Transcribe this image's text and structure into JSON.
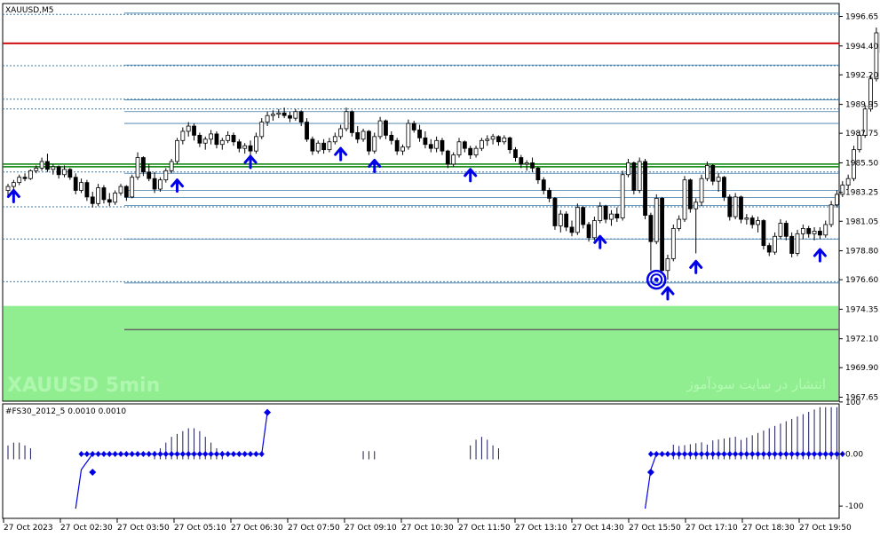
{
  "main_chart": {
    "title": "XAUUSD,M5",
    "watermark_left": "XAUUSD    5min",
    "watermark_right": "انتشار در سایت سودآموز",
    "price_ticks": [
      "1996.65",
      "1994.40",
      "1992.20",
      "1989.95",
      "1987.75",
      "1985.50",
      "1983.25",
      "1981.05",
      "1978.80",
      "1976.60",
      "1974.35",
      "1972.10",
      "1969.90",
      "1967.65"
    ],
    "price_range": [
      1967.65,
      1996.65
    ],
    "zone_band": [
      1967.65,
      1974.6
    ],
    "lines": {
      "red": 1994.6,
      "green": [
        1985.4,
        1985.2
      ],
      "solid": [
        1996.9,
        1992.95,
        1990.3,
        1989.4,
        1988.5,
        1984.7,
        1983.4,
        1982.85,
        1982.25,
        1979.7,
        1976.35,
        1972.8
      ],
      "dashed": [
        1996.8,
        1992.9,
        1990.35,
        1989.6,
        1984.8,
        1982.15,
        1979.7,
        1976.45
      ]
    },
    "arrows": [
      {
        "bar": 1,
        "price": 1983.4
      },
      {
        "bar": 30,
        "price": 1984.2
      },
      {
        "bar": 43,
        "price": 1986.0
      },
      {
        "bar": 59,
        "price": 1986.6
      },
      {
        "bar": 65,
        "price": 1985.7
      },
      {
        "bar": 82,
        "price": 1985.0
      },
      {
        "bar": 105,
        "price": 1979.9
      },
      {
        "bar": 117,
        "price": 1976.0
      },
      {
        "bar": 122,
        "price": 1978.0
      },
      {
        "bar": 144,
        "price": 1978.9
      }
    ],
    "target_marker": {
      "bar": 115,
      "price": 1976.6
    }
  },
  "indicator": {
    "title": "#FS30_2012_5 0.0010 0.0010",
    "ticks": [
      "100",
      "0.00",
      "-100"
    ],
    "range": [
      -110,
      110
    ]
  },
  "time_labels": [
    "27 Oct 2023",
    "27 Oct 02:30",
    "27 Oct 03:50",
    "27 Oct 05:10",
    "27 Oct 06:30",
    "27 Oct 07:50",
    "27 Oct 09:10",
    "27 Oct 10:30",
    "27 Oct 11:50",
    "27 Oct 13:10",
    "27 Oct 14:30",
    "27 Oct 15:50",
    "27 Oct 17:10",
    "27 Oct 18:30",
    "27 Oct 19:50"
  ],
  "colors": {
    "zone": "#90ee90",
    "red_line": "#cc0000",
    "green_line": "#008000",
    "level_line": "#3a78a8",
    "arrow": "#0000e6",
    "indicator_bar": "#1a1a5e",
    "indicator_dot": "#0000e6"
  },
  "candles": [
    [
      1983.4,
      1983.9,
      1982.9,
      1983.7
    ],
    [
      1983.7,
      1984.2,
      1983.4,
      1984.0
    ],
    [
      1984.0,
      1984.6,
      1983.8,
      1984.4
    ],
    [
      1984.4,
      1984.7,
      1984.1,
      1984.3
    ],
    [
      1984.3,
      1985.0,
      1984.2,
      1984.9
    ],
    [
      1984.9,
      1985.3,
      1984.7,
      1985.1
    ],
    [
      1985.1,
      1985.9,
      1984.9,
      1985.6
    ],
    [
      1985.6,
      1986.2,
      1984.8,
      1985.0
    ],
    [
      1985.0,
      1985.4,
      1984.6,
      1985.2
    ],
    [
      1985.2,
      1985.3,
      1984.3,
      1984.6
    ],
    [
      1984.6,
      1985.3,
      1984.4,
      1985.0
    ],
    [
      1985.0,
      1985.1,
      1984.2,
      1984.4
    ],
    [
      1984.4,
      1984.7,
      1983.1,
      1983.4
    ],
    [
      1983.4,
      1984.3,
      1983.2,
      1984.0
    ],
    [
      1984.0,
      1984.2,
      1982.6,
      1982.9
    ],
    [
      1982.9,
      1983.3,
      1982.1,
      1982.4
    ],
    [
      1982.4,
      1983.9,
      1982.2,
      1983.6
    ],
    [
      1983.6,
      1983.8,
      1982.4,
      1982.7
    ],
    [
      1982.7,
      1983.2,
      1982.2,
      1982.5
    ],
    [
      1982.5,
      1983.4,
      1982.3,
      1983.2
    ],
    [
      1983.2,
      1983.9,
      1983.0,
      1983.7
    ],
    [
      1983.7,
      1983.8,
      1982.6,
      1982.9
    ],
    [
      1982.9,
      1984.6,
      1982.8,
      1984.4
    ],
    [
      1984.4,
      1986.3,
      1984.2,
      1985.9
    ],
    [
      1985.9,
      1986.0,
      1984.5,
      1984.8
    ],
    [
      1984.8,
      1985.4,
      1984.1,
      1984.3
    ],
    [
      1984.3,
      1984.8,
      1983.2,
      1983.5
    ],
    [
      1983.5,
      1984.4,
      1983.3,
      1984.2
    ],
    [
      1984.2,
      1985.1,
      1984.0,
      1984.9
    ],
    [
      1984.9,
      1985.8,
      1984.7,
      1985.6
    ],
    [
      1985.6,
      1987.4,
      1985.4,
      1987.2
    ],
    [
      1987.2,
      1988.2,
      1986.9,
      1987.9
    ],
    [
      1987.9,
      1988.6,
      1987.5,
      1988.3
    ],
    [
      1988.3,
      1988.5,
      1987.2,
      1987.6
    ],
    [
      1987.6,
      1987.8,
      1986.7,
      1987.0
    ],
    [
      1987.0,
      1987.5,
      1986.5,
      1987.3
    ],
    [
      1987.3,
      1988.0,
      1986.9,
      1987.7
    ],
    [
      1987.7,
      1987.9,
      1986.6,
      1986.9
    ],
    [
      1986.9,
      1987.4,
      1986.5,
      1987.2
    ],
    [
      1987.2,
      1987.9,
      1987.0,
      1987.6
    ],
    [
      1987.6,
      1987.8,
      1986.8,
      1987.1
    ],
    [
      1987.1,
      1987.3,
      1986.3,
      1986.6
    ],
    [
      1986.6,
      1987.0,
      1986.2,
      1986.8
    ],
    [
      1986.8,
      1987.2,
      1986.1,
      1986.4
    ],
    [
      1986.4,
      1987.8,
      1986.2,
      1987.5
    ],
    [
      1987.5,
      1988.9,
      1987.3,
      1988.6
    ],
    [
      1988.6,
      1989.4,
      1988.3,
      1989.1
    ],
    [
      1989.1,
      1989.5,
      1988.7,
      1989.2
    ],
    [
      1989.2,
      1989.6,
      1988.9,
      1989.3
    ],
    [
      1989.3,
      1989.7,
      1988.9,
      1989.1
    ],
    [
      1989.1,
      1989.4,
      1988.6,
      1988.9
    ],
    [
      1988.9,
      1989.6,
      1988.7,
      1989.4
    ],
    [
      1989.4,
      1989.5,
      1988.3,
      1988.6
    ],
    [
      1988.6,
      1988.9,
      1987.1,
      1987.3
    ],
    [
      1987.3,
      1987.5,
      1986.1,
      1986.4
    ],
    [
      1986.4,
      1987.2,
      1986.2,
      1987.0
    ],
    [
      1987.0,
      1987.3,
      1986.2,
      1986.5
    ],
    [
      1986.5,
      1987.4,
      1986.3,
      1987.1
    ],
    [
      1987.1,
      1987.8,
      1986.9,
      1987.5
    ],
    [
      1987.5,
      1988.4,
      1987.3,
      1988.1
    ],
    [
      1988.1,
      1989.7,
      1987.9,
      1989.4
    ],
    [
      1989.4,
      1989.5,
      1987.5,
      1987.8
    ],
    [
      1987.8,
      1988.3,
      1987.0,
      1987.3
    ],
    [
      1987.3,
      1988.1,
      1987.1,
      1987.9
    ],
    [
      1987.9,
      1988.0,
      1986.1,
      1986.4
    ],
    [
      1986.4,
      1987.8,
      1986.2,
      1987.5
    ],
    [
      1987.5,
      1989.0,
      1987.3,
      1988.7
    ],
    [
      1988.7,
      1988.8,
      1987.3,
      1987.6
    ],
    [
      1987.6,
      1987.9,
      1986.9,
      1987.2
    ],
    [
      1987.2,
      1987.4,
      1986.1,
      1986.4
    ],
    [
      1986.4,
      1986.9,
      1986.1,
      1986.7
    ],
    [
      1986.7,
      1988.8,
      1986.5,
      1988.5
    ],
    [
      1988.5,
      1988.7,
      1987.8,
      1988.0
    ],
    [
      1988.0,
      1988.4,
      1987.1,
      1987.4
    ],
    [
      1987.4,
      1987.9,
      1986.6,
      1986.9
    ],
    [
      1986.9,
      1987.3,
      1986.3,
      1986.6
    ],
    [
      1986.6,
      1987.5,
      1986.3,
      1987.2
    ],
    [
      1987.2,
      1987.4,
      1986.1,
      1986.4
    ],
    [
      1986.4,
      1986.5,
      1985.1,
      1985.4
    ],
    [
      1985.4,
      1986.3,
      1985.2,
      1986.1
    ],
    [
      1986.1,
      1987.4,
      1985.9,
      1987.1
    ],
    [
      1987.1,
      1987.2,
      1986.3,
      1986.6
    ],
    [
      1986.6,
      1986.8,
      1985.8,
      1986.1
    ],
    [
      1986.1,
      1986.8,
      1985.9,
      1986.6
    ],
    [
      1986.6,
      1987.4,
      1986.4,
      1987.2
    ],
    [
      1987.2,
      1987.6,
      1986.8,
      1987.3
    ],
    [
      1987.3,
      1987.7,
      1986.9,
      1987.5
    ],
    [
      1987.5,
      1987.6,
      1986.8,
      1987.1
    ],
    [
      1987.1,
      1987.6,
      1986.9,
      1987.4
    ],
    [
      1987.4,
      1987.5,
      1986.2,
      1986.5
    ],
    [
      1986.5,
      1986.7,
      1985.6,
      1985.9
    ],
    [
      1985.9,
      1986.1,
      1985.1,
      1985.4
    ],
    [
      1985.4,
      1985.7,
      1984.9,
      1985.5
    ],
    [
      1985.5,
      1985.9,
      1984.8,
      1985.1
    ],
    [
      1985.1,
      1985.2,
      1983.9,
      1984.2
    ],
    [
      1984.2,
      1984.4,
      1983.1,
      1983.4
    ],
    [
      1983.4,
      1983.6,
      1982.5,
      1982.8
    ],
    [
      1982.8,
      1982.9,
      1980.4,
      1980.7
    ],
    [
      1980.7,
      1981.9,
      1980.2,
      1981.6
    ],
    [
      1981.6,
      1981.8,
      1980.3,
      1980.6
    ],
    [
      1980.6,
      1981.1,
      1979.9,
      1980.2
    ],
    [
      1980.2,
      1982.4,
      1980.0,
      1982.1
    ],
    [
      1982.1,
      1982.2,
      1980.5,
      1980.8
    ],
    [
      1980.8,
      1981.0,
      1979.5,
      1979.8
    ],
    [
      1979.8,
      1981.4,
      1979.6,
      1981.1
    ],
    [
      1981.1,
      1982.5,
      1980.9,
      1982.2
    ],
    [
      1982.2,
      1982.3,
      1980.9,
      1981.2
    ],
    [
      1981.2,
      1981.9,
      1980.7,
      1981.6
    ],
    [
      1981.6,
      1982.1,
      1981.0,
      1981.3
    ],
    [
      1981.3,
      1984.9,
      1981.1,
      1984.6
    ],
    [
      1984.6,
      1985.8,
      1984.4,
      1985.5
    ],
    [
      1985.5,
      1985.6,
      1983.1,
      1983.4
    ],
    [
      1983.4,
      1985.9,
      1983.2,
      1985.6
    ],
    [
      1985.6,
      1985.8,
      1981.2,
      1981.5
    ],
    [
      1981.5,
      1981.7,
      1977.3,
      1979.5
    ],
    [
      1979.5,
      1983.1,
      1979.3,
      1982.8
    ],
    [
      1982.8,
      1982.9,
      1977.0,
      1977.3
    ],
    [
      1977.3,
      1978.5,
      1976.6,
      1978.2
    ],
    [
      1978.2,
      1980.8,
      1978.0,
      1980.5
    ],
    [
      1980.5,
      1981.5,
      1980.3,
      1981.2
    ],
    [
      1981.2,
      1984.5,
      1981.0,
      1984.2
    ],
    [
      1984.2,
      1984.3,
      1981.7,
      1982.0
    ],
    [
      1982.0,
      1982.8,
      1978.6,
      1982.5
    ],
    [
      1982.5,
      1984.6,
      1982.2,
      1984.3
    ],
    [
      1984.3,
      1985.6,
      1984.1,
      1985.3
    ],
    [
      1985.3,
      1985.4,
      1983.8,
      1984.1
    ],
    [
      1984.1,
      1984.7,
      1983.3,
      1984.4
    ],
    [
      1984.4,
      1984.5,
      1982.6,
      1982.9
    ],
    [
      1982.9,
      1983.1,
      1981.1,
      1981.4
    ],
    [
      1981.4,
      1983.2,
      1981.2,
      1982.9
    ],
    [
      1982.9,
      1983.0,
      1980.9,
      1981.2
    ],
    [
      1981.2,
      1981.6,
      1980.8,
      1981.3
    ],
    [
      1981.3,
      1981.5,
      1980.5,
      1980.8
    ],
    [
      1980.8,
      1981.4,
      1980.2,
      1981.1
    ],
    [
      1981.1,
      1981.2,
      1978.9,
      1979.2
    ],
    [
      1979.2,
      1979.4,
      1978.4,
      1978.7
    ],
    [
      1978.7,
      1980.2,
      1978.5,
      1979.9
    ],
    [
      1979.9,
      1981.2,
      1979.7,
      1980.9
    ],
    [
      1980.9,
      1981.1,
      1979.6,
      1979.9
    ],
    [
      1979.9,
      1980.2,
      1978.3,
      1978.6
    ],
    [
      1978.6,
      1980.4,
      1978.4,
      1980.1
    ],
    [
      1980.1,
      1980.8,
      1979.7,
      1980.5
    ],
    [
      1980.5,
      1980.7,
      1979.8,
      1980.1
    ],
    [
      1980.1,
      1980.6,
      1979.6,
      1980.3
    ],
    [
      1980.3,
      1980.6,
      1979.7,
      1980.0
    ],
    [
      1980.0,
      1981.1,
      1979.8,
      1980.8
    ],
    [
      1980.8,
      1982.6,
      1980.6,
      1982.3
    ],
    [
      1982.3,
      1983.4,
      1982.1,
      1983.1
    ],
    [
      1983.1,
      1984.1,
      1982.9,
      1983.8
    ],
    [
      1983.8,
      1984.6,
      1983.5,
      1984.3
    ],
    [
      1984.3,
      1986.8,
      1984.1,
      1986.5
    ],
    [
      1986.5,
      1987.9,
      1986.3,
      1987.6
    ],
    [
      1987.6,
      1989.9,
      1987.4,
      1989.6
    ],
    [
      1989.6,
      1992.2,
      1989.4,
      1991.9
    ],
    [
      1991.9,
      1995.8,
      1991.7,
      1995.4
    ],
    [
      1995.4,
      1995.6,
      1993.6,
      1993.9
    ],
    [
      1993.9,
      1994.7,
      1993.3,
      1994.4
    ]
  ],
  "oscillator": [
    30,
    40,
    40,
    30,
    20,
    0,
    0,
    0,
    0,
    0,
    0,
    0,
    0,
    0,
    0,
    0,
    0,
    0,
    0,
    0,
    0,
    0,
    0,
    0,
    0,
    0,
    10,
    20,
    40,
    60,
    70,
    80,
    90,
    90,
    80,
    60,
    40,
    20,
    10,
    0,
    0,
    0,
    0,
    0,
    0,
    0,
    0,
    0,
    0,
    0,
    0,
    0,
    0,
    0,
    0,
    0,
    0,
    0,
    0,
    0,
    0,
    0,
    0,
    10,
    10,
    10,
    0,
    0,
    0,
    0,
    0,
    0,
    0,
    0,
    0,
    0,
    0,
    0,
    0,
    0,
    0,
    0,
    30,
    50,
    60,
    50,
    30,
    20,
    0,
    0,
    0,
    0,
    0,
    0,
    0,
    0,
    0,
    0,
    0,
    0,
    0,
    0,
    0,
    0,
    0,
    0,
    0,
    0,
    0,
    0,
    0,
    0,
    0,
    0,
    0,
    0,
    0,
    0,
    0,
    0,
    0,
    0,
    0,
    0,
    10,
    10,
    0,
    0,
    0,
    0,
    0,
    0,
    0,
    0,
    0,
    0,
    0,
    0,
    0,
    0,
    0,
    0,
    0,
    0,
    0,
    0,
    0,
    0,
    0,
    0,
    0,
    0,
    0,
    0,
    0,
    0,
    0,
    0,
    0,
    0,
    0,
    0,
    0,
    0,
    0,
    0,
    0,
    0,
    0,
    0,
    0,
    0,
    0,
    0,
    0,
    0,
    0,
    0,
    0,
    0
  ]
}
